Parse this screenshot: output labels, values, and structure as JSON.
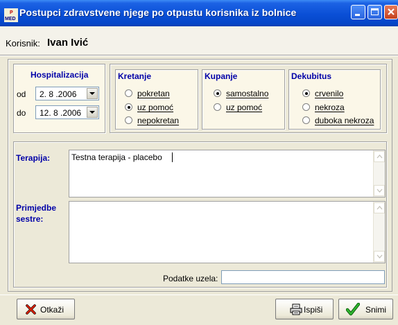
{
  "window": {
    "title": "Postupci zdravstvene njege po otpustu korisnika iz bolnice",
    "app_icon_letters": "P MED"
  },
  "user": {
    "label": "Korisnik:",
    "name": "Ivan Ivić"
  },
  "hospitalizacija": {
    "title": "Hospitalizacija",
    "od_label": "od",
    "od_value": "2. 8 .2006",
    "do_label": "do",
    "do_value": "12. 8 .2006"
  },
  "kretanje": {
    "title": "Kretanje",
    "options": [
      {
        "label": "pokretan",
        "selected": false
      },
      {
        "label": "uz pomoć",
        "selected": true
      },
      {
        "label": "nepokretan",
        "selected": false
      }
    ]
  },
  "kupanje": {
    "title": "Kupanje",
    "options": [
      {
        "label": "samostalno",
        "selected": true
      },
      {
        "label": "uz pomoć",
        "selected": false
      }
    ]
  },
  "dekubitus": {
    "title": "Dekubitus",
    "options": [
      {
        "label": "crvenilo",
        "selected": true
      },
      {
        "label": "nekroza",
        "selected": false
      },
      {
        "label": "duboka nekroza",
        "selected": false
      }
    ]
  },
  "terapija": {
    "label": "Terapija:",
    "value": "Testna terapija - placebo"
  },
  "primjedbe": {
    "label_line1": "Primjedbe",
    "label_line2": "sestre:",
    "value": ""
  },
  "podatke": {
    "label": "Podatke uzela:",
    "value": ""
  },
  "buttons": {
    "cancel_label": "Otkaži",
    "print_label": "Ispiši",
    "save_label": "Snimi"
  },
  "icons": {
    "cancel": "red-x-icon",
    "print": "printer-icon",
    "save": "green-checkmark-icon",
    "app": "med-app-icon"
  },
  "colors": {
    "titlebar": "#0a4fd6",
    "group_title": "#0000a8",
    "panel_bg": "#ece9d8",
    "group_bg": "#fbf7e8"
  }
}
